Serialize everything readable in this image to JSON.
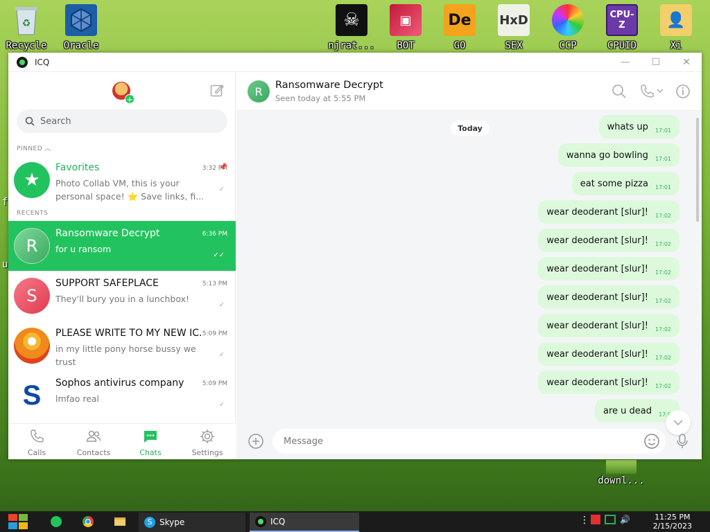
{
  "desktop": {
    "icons": [
      {
        "label": "Recycle",
        "icon": "recycle-bin-icon"
      },
      {
        "label": "Oracle",
        "icon": "virtualbox-icon"
      },
      {
        "label": "njrat...",
        "icon": "skull-icon"
      },
      {
        "label": "BOT",
        "icon": "bot-app-icon"
      },
      {
        "label": "GO",
        "icon": "die-icon"
      },
      {
        "label": "SEX",
        "icon": "hxd-icon"
      },
      {
        "label": "CCP",
        "icon": "color-wheel-icon"
      },
      {
        "label": "CPUID",
        "icon": "cpuz-icon"
      },
      {
        "label": "Xi",
        "icon": "user-folder-icon"
      }
    ],
    "edge_chars": [
      "f",
      "u"
    ],
    "bottom_icon_label": "downl..."
  },
  "window": {
    "title": "ICQ",
    "controls": [
      "—",
      "☐",
      "✕"
    ]
  },
  "sidebar": {
    "search_placeholder": "Search",
    "pinned_label": "PINNED",
    "recents_label": "RECENTS",
    "pinned": [
      {
        "name": "Favorites",
        "time": "3:32 PM",
        "preview": "Photo Collab VM, this is your personal space! ⭐ Save links, fi...",
        "avatar_color": "#22c35e"
      }
    ],
    "recents": [
      {
        "name": "Ransomware Decrypt",
        "time": "6:36 PM",
        "preview": "for u ransom",
        "initial": "R",
        "avatar_color": "#6dc98a",
        "active": true
      },
      {
        "name": "SUPPORT SAFEPLACE",
        "time": "5:13 PM",
        "preview": "They'll bury you in a lunchbox!",
        "initial": "S",
        "avatar_color": "#ef5466",
        "active": false
      },
      {
        "name": "PLEASE WRITE TO MY NEW IC...",
        "time": "5:09 PM",
        "preview": "in my little pony horse bussy we trust",
        "initial": "",
        "avatar_color": "#f39a1e",
        "active": false
      },
      {
        "name": "Sophos antivirus company",
        "time": "5:09 PM",
        "preview": "lmfao real",
        "initial": "S",
        "avatar_color": "#ffffff",
        "active": false
      }
    ],
    "nav": [
      {
        "label": "Calls",
        "icon": "phone-icon",
        "active": false
      },
      {
        "label": "Contacts",
        "icon": "contacts-icon",
        "active": false
      },
      {
        "label": "Chats",
        "icon": "chat-bubble-icon",
        "active": true
      },
      {
        "label": "Settings",
        "icon": "gear-icon",
        "active": false
      }
    ]
  },
  "chat": {
    "name": "Ransomware Decrypt",
    "initial": "R",
    "status": "Seen today at 5:55 PM",
    "day_label": "Today",
    "messages": [
      {
        "text": "whats up",
        "time": "17:01"
      },
      {
        "text": "wanna go bowling",
        "time": "17:01"
      },
      {
        "text": "eat some pizza",
        "time": "17:01"
      },
      {
        "text": "wear deoderant [slur]!",
        "time": "17:02"
      },
      {
        "text": "wear deoderant [slur]!",
        "time": "17:02"
      },
      {
        "text": "wear deoderant [slur]!",
        "time": "17:02"
      },
      {
        "text": "wear deoderant [slur]!",
        "time": "17:02"
      },
      {
        "text": "wear deoderant [slur]!",
        "time": "17:02"
      },
      {
        "text": "wear deoderant [slur]!",
        "time": "17:02"
      },
      {
        "text": "wear deoderant [slur]!",
        "time": "17:02"
      },
      {
        "text": "are u dead",
        "time": "17:0"
      }
    ],
    "input_placeholder": "Message"
  },
  "taskbar": {
    "tasks": [
      {
        "label": "Skype",
        "icon": "skype-icon"
      },
      {
        "label": "ICQ",
        "icon": "icq-icon"
      }
    ],
    "clock_time": "11:25 PM",
    "clock_date": "2/15/2023"
  },
  "colors": {
    "accent": "#22c35e",
    "bubble": "#dcf9dc",
    "taskbar": "#1b1b1b"
  }
}
